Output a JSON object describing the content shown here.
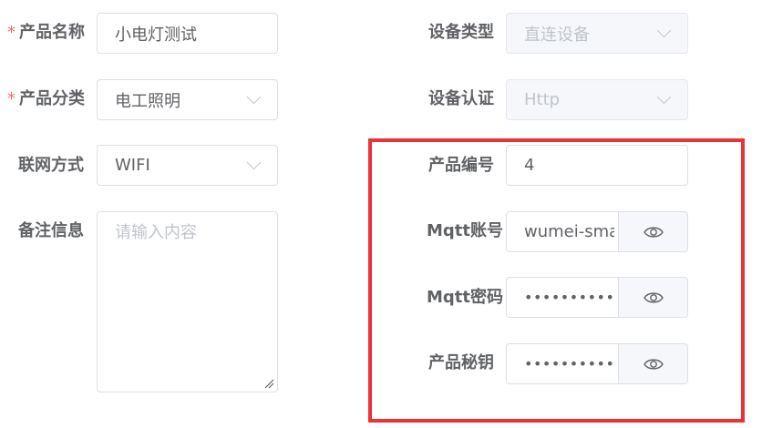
{
  "form": {
    "product_name": {
      "required_mark": "*",
      "label": "产品名称",
      "value": "小电灯测试"
    },
    "product_category": {
      "required_mark": "*",
      "label": "产品分类",
      "value": "电工照明"
    },
    "network_method": {
      "label": "联网方式",
      "value": "WIFI"
    },
    "remark": {
      "label": "备注信息",
      "placeholder": "请输入内容"
    },
    "device_type": {
      "label": "设备类型",
      "value": "直连设备"
    },
    "device_auth": {
      "label": "设备认证",
      "value": "Http"
    },
    "product_id": {
      "label": "产品编号",
      "value": "4"
    },
    "mqtt_account": {
      "label": "Mqtt账号",
      "value": "wumei-smart"
    },
    "mqtt_password": {
      "label": "Mqtt密码",
      "value": "••••••••••••••"
    },
    "product_secret": {
      "label": "产品秘钥",
      "value": "••••••••••••••"
    }
  },
  "colors": {
    "highlight_border": "#ed3237",
    "required": "#f56c6c",
    "label": "#606266",
    "disabled_bg": "#f5f7fa"
  },
  "icons": {
    "select_arrow": "chevron-down-icon",
    "reveal": "eye-icon",
    "resize": "resize-grip-icon"
  }
}
